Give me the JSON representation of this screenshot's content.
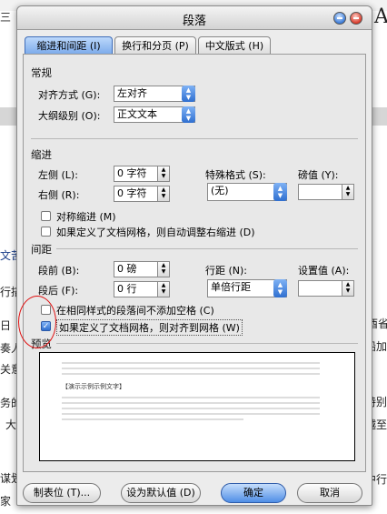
{
  "background": {
    "left_texts": [
      "三",
      "文苦",
      "行描",
      "日",
      "奏人",
      "关意",
      "务的",
      "大",
      "谋划",
      "家"
    ],
    "right_texts": [
      "A",
      "酉省",
      "船加",
      "特别",
      "越至",
      "中行"
    ]
  },
  "dialog": {
    "title": "段落",
    "tabs": [
      {
        "label": "缩进和间距 (I)",
        "active": true
      },
      {
        "label": "换行和分页 (P)",
        "active": false
      },
      {
        "label": "中文版式 (H)",
        "active": false
      }
    ],
    "general": {
      "header": "常规",
      "alignment_label": "对齐方式 (G):",
      "alignment_value": "左对齐",
      "outline_label": "大纲级别 (O):",
      "outline_value": "正文文本"
    },
    "indent": {
      "header": "缩进",
      "left_label": "左侧 (L):",
      "left_value": "0 字符",
      "right_label": "右侧 (R):",
      "right_value": "0 字符",
      "special_label": "特殊格式 (S):",
      "special_value": "(无)",
      "by_label": "磅值 (Y):",
      "by_value": "",
      "mirror_label": "对称缩进 (M)",
      "mirror_checked": false,
      "auto_adjust_label": "如果定义了文档网格，则自动调整右缩进 (D)",
      "auto_adjust_checked": false
    },
    "spacing": {
      "header": "间距",
      "before_label": "段前 (B):",
      "before_value": "0 磅",
      "after_label": "段后 (F):",
      "after_value": "0 行",
      "line_label": "行距 (N):",
      "line_value": "单倍行距",
      "at_label": "设置值 (A):",
      "at_value": "",
      "no_space_label": "在相同样式的段落间不添加空格 (C)",
      "no_space_checked": false,
      "snap_grid_label": "如果定义了文档网格，则对齐到网格 (W)",
      "snap_grid_checked": true
    },
    "preview": {
      "header": "预览",
      "sample_text": "【演示示例示例文字】"
    },
    "buttons": {
      "tabs": "制表位 (T)...",
      "default": "设为默认值 (D)",
      "ok": "确定",
      "cancel": "取消"
    }
  },
  "colors": {
    "accent": "#3b7bd8",
    "close": "#d83a2a",
    "annotation": "#e01010"
  }
}
